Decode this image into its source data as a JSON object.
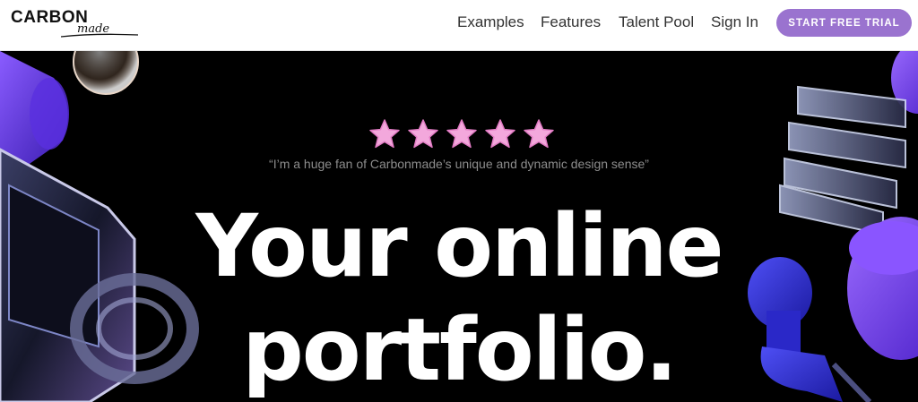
{
  "brand": {
    "name": "CARBON",
    "script": "made"
  },
  "nav": {
    "links": [
      "Examples",
      "Features",
      "Talent Pool",
      "Sign In"
    ],
    "cta": "START FREE TRIAL"
  },
  "hero": {
    "rating": 5,
    "quote": "“I’m a huge fan of Carbonmade’s unique and dynamic design sense”",
    "headline_line1": "Your online",
    "headline_line2": "portfolio."
  },
  "colors": {
    "cta_bg": "#9a73cf",
    "star_pink": "#f3a8dc",
    "purple_shape": "#6a3cf0"
  }
}
